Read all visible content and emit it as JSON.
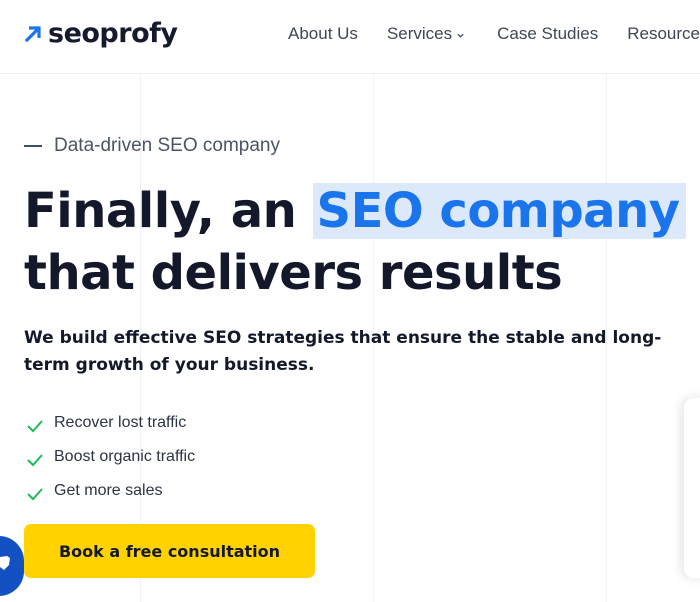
{
  "header": {
    "logo_text": "seoprofy",
    "nav": [
      {
        "label": "About Us"
      },
      {
        "label": "Services"
      },
      {
        "label": "Case Studies"
      },
      {
        "label": "Resources"
      }
    ]
  },
  "hero": {
    "eyebrow": "Data-driven SEO company",
    "headline_part1": "Finally, an",
    "headline_highlight": "SEO company",
    "headline_part2": "that delivers results",
    "subline": "We build effective SEO strategies that ensure the stable and long-term growth of your business.",
    "checklist": [
      {
        "text": "Recover lost traffic"
      },
      {
        "text": "Boost organic traffic"
      },
      {
        "text": "Get more sales"
      }
    ],
    "cta_label": "Book a free consultation"
  },
  "icons": {
    "logo": "arrow-up-right-icon",
    "dropdown": "chevron-down-icon",
    "check": "check-icon",
    "badge": "shield-icon"
  },
  "colors": {
    "accent_blue": "#1a74ec",
    "highlight_bg": "#dbe9fb",
    "cta_yellow": "#ffd200",
    "check_green": "#1fba5a",
    "text_dark": "#13192b"
  }
}
